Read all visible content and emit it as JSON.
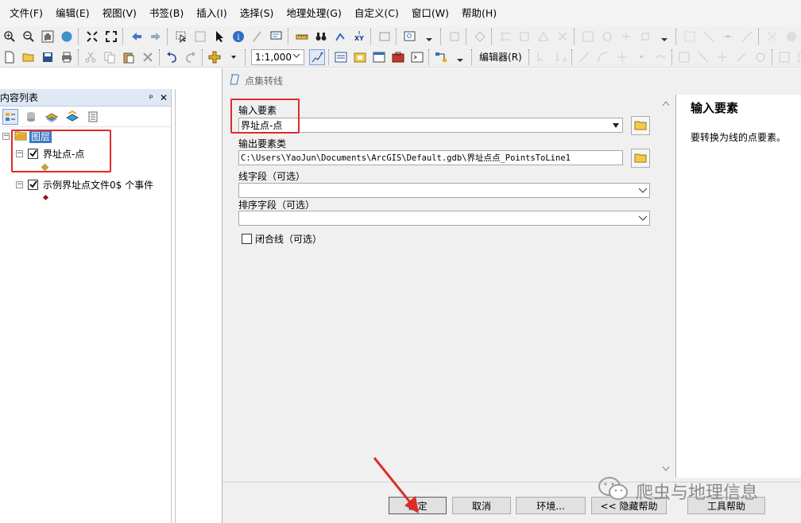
{
  "menubar": {
    "items": [
      "文件(F)",
      "编辑(E)",
      "视图(V)",
      "书签(B)",
      "插入(I)",
      "选择(S)",
      "地理处理(G)",
      "自定义(C)",
      "窗口(W)",
      "帮助(H)"
    ]
  },
  "toolbar": {
    "scale_value": "1:1,000",
    "editor_label": "编辑器(R)"
  },
  "toc": {
    "title": "内容列表",
    "pin_label": "ᵖ",
    "close_label": "✕",
    "root_layer": "图层",
    "layers": [
      {
        "name": "界址点-点",
        "checked": true,
        "symbol_color": "#c8a04a"
      },
      {
        "name": "示例界址点文件0$ 个事件",
        "checked": true,
        "symbol_color": "#8b1a1a"
      }
    ]
  },
  "dialog": {
    "title": "点集转线",
    "input_features_label": "输入要素",
    "input_features_value": "界址点-点",
    "output_class_label": "输出要素类",
    "output_class_value": "C:\\Users\\YaoJun\\Documents\\ArcGIS\\Default.gdb\\界址点点_PointsToLine1",
    "line_field_label": "线字段（可选）",
    "line_field_value": "",
    "sort_field_label": "排序字段（可选）",
    "sort_field_value": "",
    "close_line_label": "闭合线（可选）",
    "close_line_checked": false
  },
  "help": {
    "title": "输入要素",
    "text": "要转换为线的点要素。"
  },
  "buttons": {
    "ok": "确定",
    "cancel": "取消",
    "environments": "环境...",
    "hide_help": "<< 隐藏帮助",
    "tool_help": "工具帮助"
  },
  "watermark": {
    "text": "爬虫与地理信息"
  },
  "colors": {
    "annotation_red": "#e02a2a",
    "selection_blue": "#3d78c8"
  }
}
